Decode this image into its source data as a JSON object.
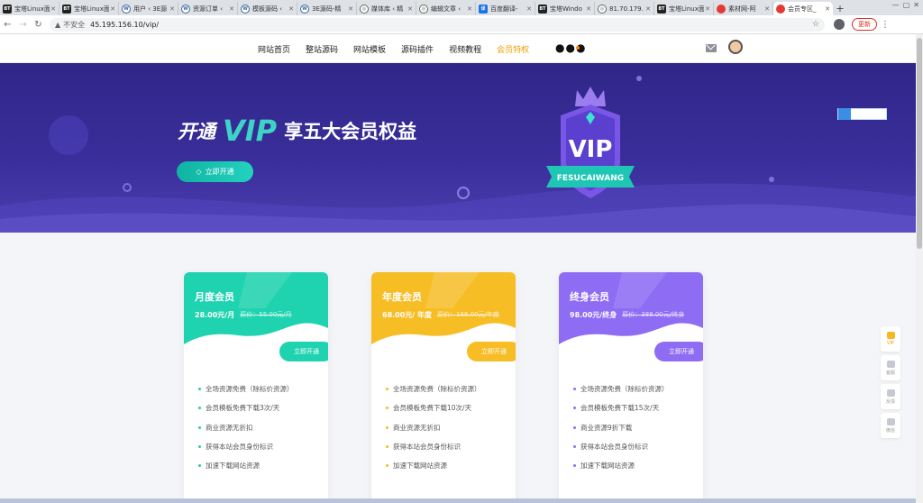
{
  "browser": {
    "tabs": [
      {
        "icon": "bt",
        "title": "宝塔Linux面"
      },
      {
        "icon": "bt",
        "title": "宝塔Linux面"
      },
      {
        "icon": "wp",
        "title": "用户 ‹ 3E源"
      },
      {
        "icon": "wp",
        "title": "资源订单 ‹"
      },
      {
        "icon": "wp",
        "title": "模板源码 ‹"
      },
      {
        "icon": "wp",
        "title": "3E源码-精"
      },
      {
        "icon": "globe",
        "title": "媒体库 ‹ 精"
      },
      {
        "icon": "globe",
        "title": "编辑文章 ‹"
      },
      {
        "icon": "fy",
        "title": "百度翻译-"
      },
      {
        "icon": "bt",
        "title": "宝塔Windo"
      },
      {
        "icon": "globe",
        "title": "81.70.179."
      },
      {
        "icon": "bt",
        "title": "宝塔Linux面"
      },
      {
        "icon": "red",
        "title": "素材网-阿"
      },
      {
        "icon": "red",
        "title": "会员专区_",
        "active": true
      }
    ],
    "insecure_label": "不安全",
    "url": "45.195.156.10/vip/",
    "update_label": "更新"
  },
  "nav": {
    "items": [
      "网站首页",
      "整站源码",
      "网站模板",
      "源码插件",
      "视频教程"
    ],
    "vip_item": "会员特权",
    "more": "●●●"
  },
  "banner": {
    "prefix": "开通",
    "vip": "VIP",
    "suffix": "享五大会员权益",
    "open_button": "立即开通",
    "shield_text": "VIP",
    "ribbon_text": "FESUCAIWANG"
  },
  "plans": [
    {
      "name": "月度会员",
      "price": "28.00元/月",
      "original": "原价：55.00元/月",
      "button": "立即开通",
      "color": "#1fd3b0",
      "features": [
        "全场资源免费（除标价资源）",
        "会员模板免费下载3次/天",
        "商业资源无折扣",
        "获得本站会员身份标识",
        "加速下载网站资源"
      ]
    },
    {
      "name": "年度会员",
      "price": "68.00元/ 年度",
      "original": "原价：168.00元/年度",
      "button": "立即开通",
      "color": "#f7bd25",
      "features": [
        "全场资源免费（除标价资源）",
        "会员模板免费下载10次/天",
        "商业资源无折扣",
        "获得本站会员身份标识",
        "加速下载网站资源"
      ]
    },
    {
      "name": "终身会员",
      "price": "98.00元/终身",
      "original": "原价：388.00元/终身",
      "button": "立即开通",
      "color": "#8e6cf4",
      "features": [
        "全场资源免费（除标价资源）",
        "会员模板免费下载15次/天",
        "商业资源9折下载",
        "获得本站会员身份标识",
        "加速下载网站资源"
      ]
    }
  ],
  "sidebar": [
    "VIP",
    "客服",
    "反馈",
    "微信"
  ]
}
